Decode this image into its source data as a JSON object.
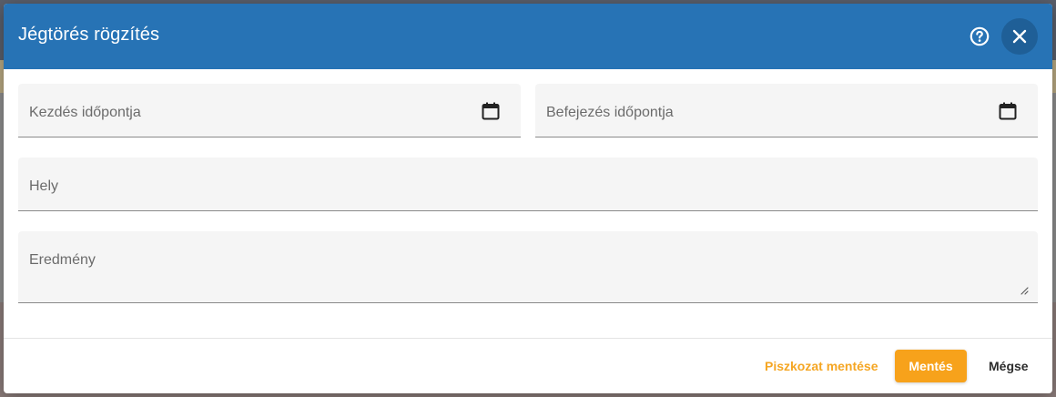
{
  "dialog": {
    "title": "Jégtörés rögzítés",
    "help_icon": "help-circle-icon",
    "close_icon": "close-icon"
  },
  "form": {
    "start_label": "Kezdés időpontja",
    "end_label": "Befejezés időpontja",
    "location_label": "Hely",
    "result_label": "Eredmény",
    "calendar_icon": "calendar-icon"
  },
  "footer": {
    "draft_label": "Piszkozat mentése",
    "save_label": "Mentés",
    "cancel_label": "Mégse"
  },
  "colors": {
    "header": "#2773b5",
    "accent": "#f7a21b",
    "draft_text": "#f5a623"
  }
}
